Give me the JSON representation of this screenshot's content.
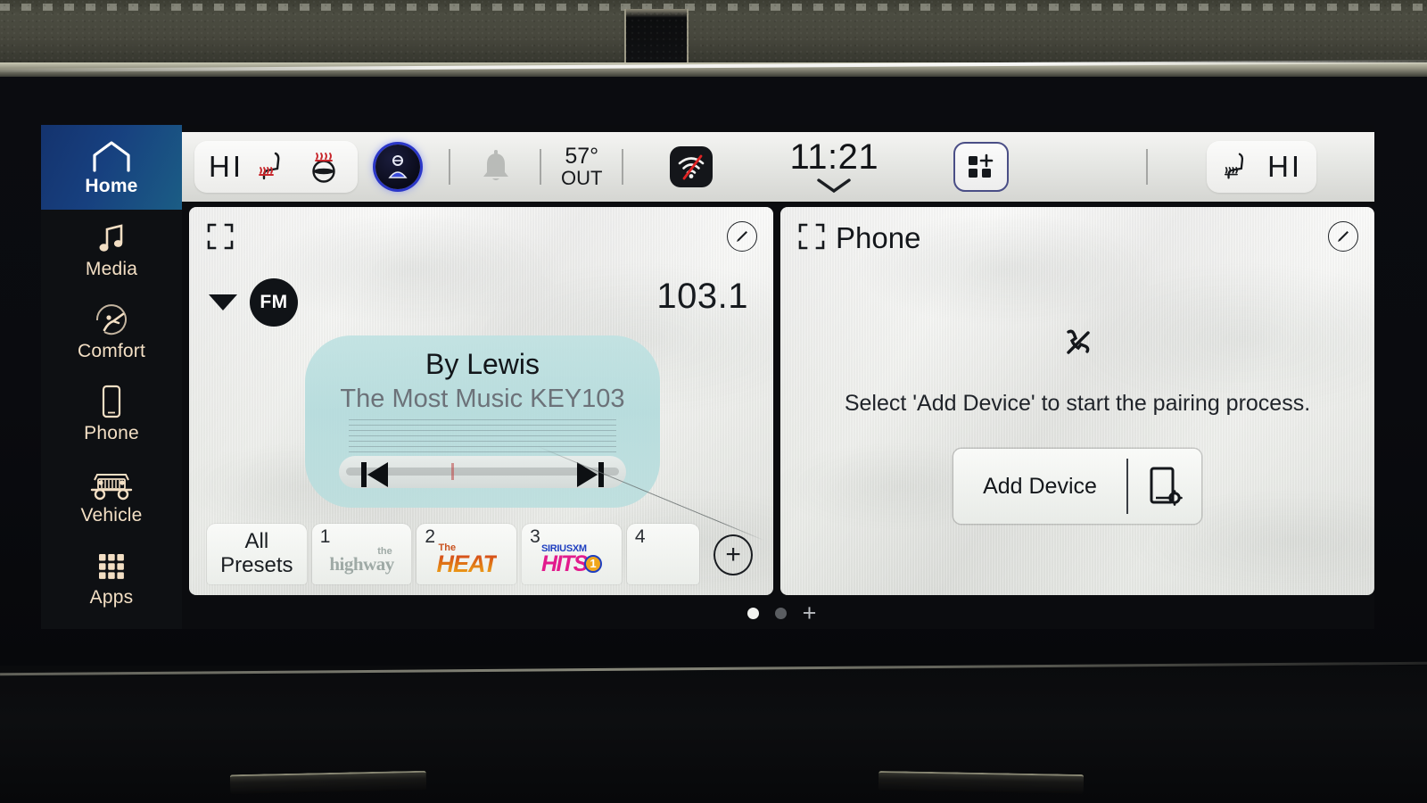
{
  "device": {
    "type": "automotive-infotainment-touchscreen"
  },
  "sidebar": {
    "items": [
      {
        "label": "Home",
        "icon": "home-icon",
        "active": true
      },
      {
        "label": "Media",
        "icon": "music-note-icon",
        "active": false
      },
      {
        "label": "Comfort",
        "icon": "comfort-seat-icon",
        "active": false
      },
      {
        "label": "Phone",
        "icon": "smartphone-icon",
        "active": false
      },
      {
        "label": "Vehicle",
        "icon": "jeep-vehicle-icon",
        "active": false
      },
      {
        "label": "Apps",
        "icon": "grid-apps-icon",
        "active": false
      }
    ]
  },
  "statusbar": {
    "left_climate": "HI",
    "right_climate": "HI",
    "heated_seat_icon": "heated-seat-icon",
    "heated_steering_icon": "heated-steering-wheel-icon",
    "right_heated_seat_icon": "heated-seat-icon",
    "profile_icon": "driver-profile-icon",
    "notification_icon": "bell-icon",
    "temperature": "57°",
    "temperature_label": "OUT",
    "wifi_icon": "wifi-off-icon",
    "clock": "11:21",
    "clock_chevron_icon": "chevron-down-icon",
    "apps_grid_icon": "add-widget-grid-icon"
  },
  "radio_widget": {
    "expand_icon": "expand-fullscreen-icon",
    "edit_icon": "edit-pencil-icon",
    "band": "FM",
    "band_chevron_icon": "caret-down-icon",
    "frequency": "103.1",
    "now_playing_title": "By Lewis",
    "now_playing_subtitle": "The Most Music KEY103",
    "prev_icon": "skip-previous-icon",
    "next_icon": "skip-next-icon",
    "presets": [
      {
        "number": "",
        "label_line1": "All",
        "label_line2": "Presets",
        "kind": "all-presets"
      },
      {
        "number": "1",
        "station": "the highway",
        "kind": "logo-highway"
      },
      {
        "number": "2",
        "station": "The HEAT",
        "kind": "logo-heat"
      },
      {
        "number": "3",
        "station": "SiriusXM Hits 1",
        "kind": "logo-hits1"
      },
      {
        "number": "4",
        "station": "",
        "kind": "empty-add"
      }
    ],
    "add_preset_icon": "plus-circle-icon"
  },
  "phone_widget": {
    "expand_icon": "expand-fullscreen-icon",
    "edit_icon": "edit-pencil-icon",
    "title": "Phone",
    "status_icon": "phone-disconnected-icon",
    "message": "Select 'Add Device' to start the pairing process.",
    "add_device_label": "Add Device",
    "add_device_icon": "phone-settings-icon"
  },
  "pagination": {
    "dots": [
      {
        "active": true
      },
      {
        "active": false
      }
    ],
    "add_page_icon": "plus-icon"
  },
  "colors": {
    "accent_blue": "#17407f",
    "rail_background": "#0e1013",
    "rail_icon": "#f3dfc4",
    "card_background": "#f0f1ee",
    "now_playing": "#b3dbdc",
    "heat_red": "#d4431b",
    "hits_pink": "#e21b8d",
    "hits_blue": "#1f3fc0"
  }
}
